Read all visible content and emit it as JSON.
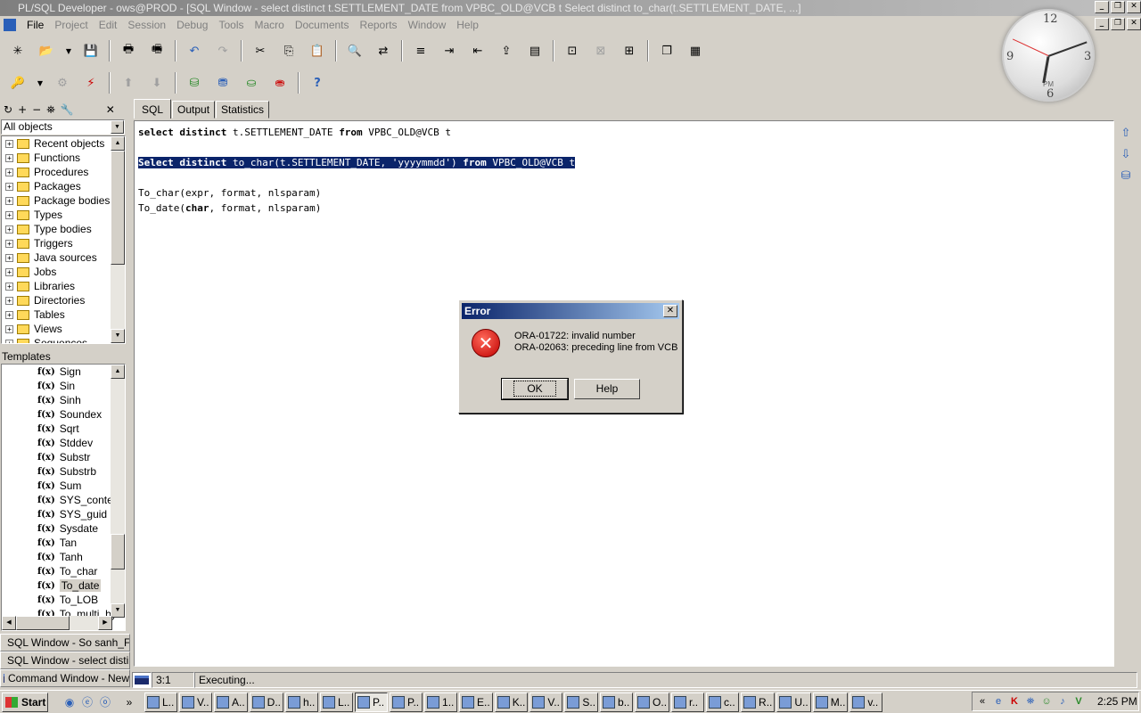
{
  "window": {
    "title": "PL/SQL Developer - ows@PROD - [SQL Window - select distinct t.SETTLEMENT_DATE from VPBC_OLD@VCB t Select distinct to_char(t.SETTLEMENT_DATE, ...]"
  },
  "menu": [
    "File",
    "Project",
    "Edit",
    "Session",
    "Debug",
    "Tools",
    "Macro",
    "Documents",
    "Reports",
    "Window",
    "Help"
  ],
  "object_browser": {
    "filter_value": "All objects",
    "items": [
      "Recent objects",
      "Functions",
      "Procedures",
      "Packages",
      "Package bodies",
      "Types",
      "Type bodies",
      "Triggers",
      "Java sources",
      "Jobs",
      "Libraries",
      "Directories",
      "Tables",
      "Views",
      "Sequences"
    ]
  },
  "templates": {
    "title": "Templates",
    "items": [
      "Sign",
      "Sin",
      "Sinh",
      "Soundex",
      "Sqrt",
      "Stddev",
      "Substr",
      "Substrb",
      "Sum",
      "SYS_context",
      "SYS_guid",
      "Sysdate",
      "Tan",
      "Tanh",
      "To_char",
      "To_date",
      "To_LOB",
      "To_multi_byte"
    ],
    "selected": "To_date"
  },
  "window_list": [
    "SQL Window - So sanh_Fi",
    "SQL Window - select distir",
    "Command Window - New"
  ],
  "tabs": [
    "SQL",
    "Output",
    "Statistics"
  ],
  "editor": {
    "line1_kw1": "select distinct",
    "line1_rest": " t.SETTLEMENT_DATE ",
    "line1_kw2": "from",
    "line1_tail": " VPBC_OLD@VCB t",
    "line2_kw1": "Select distinct",
    "line2_rest": " to_char(t.SETTLEMENT_DATE, 'yyyymmdd') ",
    "line2_kw2": "from",
    "line2_tail": " VPBC_OLD@VCB t",
    "line3": "To_char(expr, format, nlsparam)",
    "line4_a": "To_date(",
    "line4_kw": "char",
    "line4_b": ", format, nlsparam)"
  },
  "status": {
    "position": "3:1",
    "message": "Executing..."
  },
  "dialog": {
    "title": "Error",
    "line1": "ORA-01722: invalid number",
    "line2": "ORA-02063: preceding line from VCB",
    "ok": "OK",
    "help": "Help"
  },
  "clock": {
    "n12": "12",
    "n3": "3",
    "n6": "6",
    "n9": "9",
    "ampm": "PM"
  },
  "taskbar": {
    "start": "Start",
    "tasks": [
      "L..",
      "V..",
      "A..",
      "D..",
      "h..",
      "L..",
      "P..",
      "P..",
      "1..",
      "E..",
      "K..",
      "V..",
      "S..",
      "b..",
      "O..",
      "r..",
      "c..",
      "R..",
      "U..",
      "M..",
      "v.."
    ],
    "active_index": 6,
    "time": "2:25 PM"
  }
}
